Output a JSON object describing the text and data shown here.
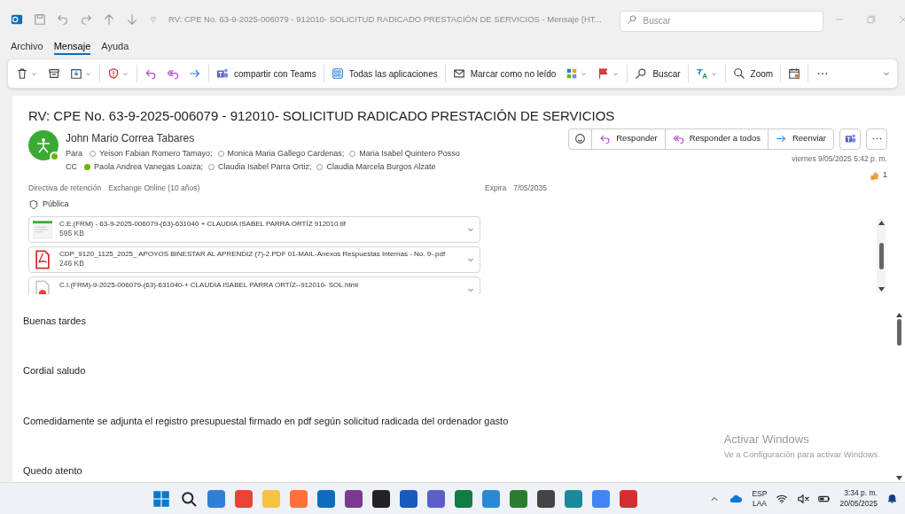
{
  "window": {
    "title": "RV: CPE No.  63-9-2025-006079 - 912010- SOLICITUD RADICADO PRESTACIÓN DE SERVICIOS  -  Mensaje (HT...",
    "search_placeholder": "Buscar"
  },
  "menu": [
    {
      "label": "Archivo",
      "selected": false
    },
    {
      "label": "Mensaje",
      "selected": true
    },
    {
      "label": "Ayuda",
      "selected": false
    }
  ],
  "ribbon": [
    [
      {
        "caret": true
      },
      {
        "caret": false
      },
      {
        "caret": true
      }
    ],
    [
      {
        "caret": true
      }
    ],
    [
      {
        "caret": false
      },
      {
        "caret": false
      },
      {
        "caret": false
      }
    ],
    [
      {
        "label": "compartir con Teams",
        "caret": false
      }
    ],
    [
      {
        "label": "Todas las aplicaciones",
        "caret": false
      }
    ],
    [
      {
        "label": "Marcar como no leído",
        "caret": false
      },
      {
        "caret": true
      },
      {
        "caret": true
      }
    ],
    [
      {
        "label": "Buscar",
        "caret": false
      }
    ],
    [
      {
        "caret": true
      }
    ],
    [
      {
        "label": "Zoom",
        "caret": false
      }
    ],
    [
      {
        "caret": false
      }
    ]
  ],
  "message": {
    "subject": "RV: CPE No.  63-9-2025-006079 - 912010- SOLICITUD RADICADO PRESTACIÓN DE SERVICIOS",
    "sender": "John Mario Correa Tabares",
    "to_label": "Para",
    "to": [
      {
        "name": "Yeison Fabian Romero Tamayo;",
        "available": false
      },
      {
        "name": "Monica Maria Gallego Cardenas;",
        "available": false
      },
      {
        "name": "Maria Isabel Quintero Posso",
        "available": false
      }
    ],
    "cc_label": "CC",
    "cc": [
      {
        "name": "Paola Andrea Vanegas Loaiza;",
        "available": true
      },
      {
        "name": "Claudia Isabel Parra Ortiz;",
        "available": false
      },
      {
        "name": "Claudia Marcela Burgos Alzate",
        "available": false
      }
    ],
    "actions": [
      "Responder",
      "Responder a todos",
      "Reenviar"
    ],
    "date": "viernes 9/05/2025 5:42 p. m.",
    "reaction_count": "1",
    "retention_label": "Directiva de retención",
    "retention_value": "Exchange Online (10 años)",
    "expires_label": "Expira",
    "expires_value": "7/05/2035",
    "sensitivity": "Pública",
    "attachments": [
      {
        "kind": "image",
        "name": "C.E.(FRM) - 63-9-2025-006079-(63)-631040 + CLAUDIA ISABEL PARRA ORTÍZ  912010.tif",
        "size": "595 KB"
      },
      {
        "kind": "pdf",
        "name": "CDP_9120_1125_2025_ APOYOS BINESTAR AL APRENDIZ (7)-2.PDF 01-MAIL-Anexos Respuestas Internas - No. 9-.pdf",
        "size": "246 KB"
      },
      {
        "kind": "html",
        "name": "C.I.(FRM)-9-2025-006079-(63)-631040-+ CLAUDIA ISABEL PARRA ORTÍZ--912010- SOL.html"
      }
    ],
    "body": [
      "Buenas tardes",
      "Cordial saludo",
      "Comedidamente se adjunta el registro presupuestal firmado en pdf según solicitud radicada del ordenador gasto",
      "Quedo atento"
    ]
  },
  "activation_notice": {
    "title": "Activar Windows",
    "text": "Ve a Configuración para activar Windows."
  },
  "taskbar": {
    "apps": [
      {
        "kind": "start"
      },
      {
        "kind": "search"
      },
      {
        "kind": "app",
        "color": "#2f7fd8"
      },
      {
        "kind": "app",
        "color": "#e84335"
      },
      {
        "kind": "app",
        "color": "#f5c242"
      },
      {
        "kind": "app",
        "color": "#ff7139"
      },
      {
        "kind": "app",
        "color": "#0f6cbd"
      },
      {
        "kind": "app",
        "color": "#7a3b8f"
      },
      {
        "kind": "app",
        "color": "#222222"
      },
      {
        "kind": "app",
        "color": "#185abd"
      },
      {
        "kind": "app",
        "color": "#5b5fc7"
      },
      {
        "kind": "app",
        "color": "#107c41"
      },
      {
        "kind": "app",
        "color": "#2b88d8"
      },
      {
        "kind": "app",
        "color": "#2a7d2e"
      },
      {
        "kind": "app",
        "color": "#444444"
      },
      {
        "kind": "app",
        "color": "#1a8a9a"
      },
      {
        "kind": "app",
        "color": "#4285f4"
      },
      {
        "kind": "app",
        "color": "#d32f2f"
      }
    ],
    "language": "ESP",
    "layout": "LAA",
    "time": "3:34 p. m.",
    "date": "20/05/2025"
  }
}
